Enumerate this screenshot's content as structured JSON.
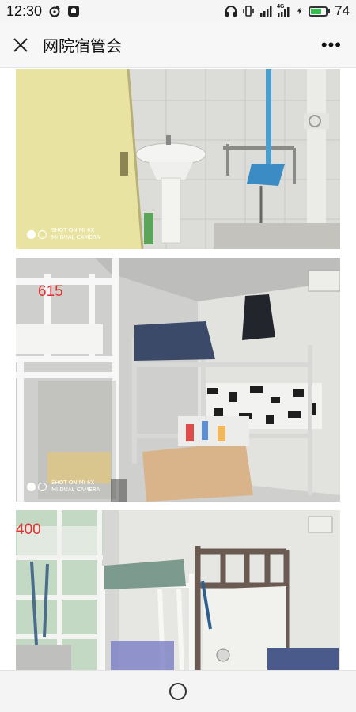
{
  "status_bar": {
    "time": "12:30",
    "battery_level": "74",
    "network_label": "4G",
    "icons": [
      "weibo-icon",
      "notification-icon",
      "headphones-icon",
      "vibrate-icon",
      "signal-icon",
      "signal-4g-icon",
      "charging-icon",
      "battery-icon"
    ]
  },
  "nav": {
    "title": "网院宿管会",
    "close_icon": "close-icon",
    "more_label": "•••"
  },
  "photos": [
    {
      "watermark_line1": "SHOT ON MI 6X",
      "watermark_line2": "MI DUAL CAMERA",
      "room_number": ""
    },
    {
      "watermark_line1": "SHOT ON MI 6X",
      "watermark_line2": "MI DUAL CAMERA",
      "room_number": "615"
    },
    {
      "watermark_line1": "",
      "watermark_line2": "",
      "room_number": "400"
    }
  ],
  "colors": {
    "room_number": "#e03030",
    "battery_fill": "#2fbf4f",
    "door": "#e9e3a2"
  },
  "bottom_nav": {
    "home_icon": "home-circle-icon"
  }
}
